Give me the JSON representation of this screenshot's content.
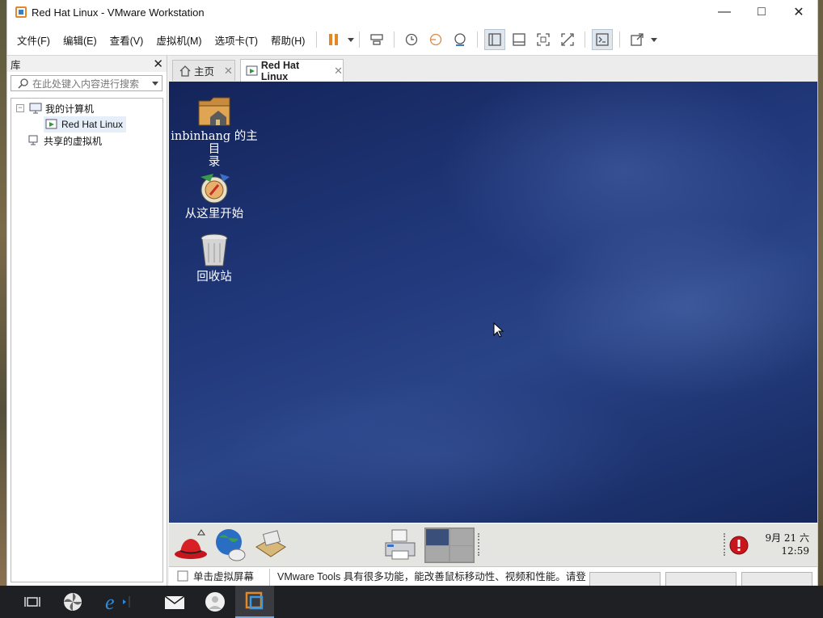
{
  "window": {
    "title": "Red Hat Linux  - VMware Workstation"
  },
  "menu": [
    "文件(F)",
    "编辑(E)",
    "查看(V)",
    "虚拟机(M)",
    "选项卡(T)",
    "帮助(H)"
  ],
  "toolbar": {
    "icons": [
      "pause-icon",
      "send-ctrl-alt-del-icon",
      "snapshot-icon",
      "revert-snapshot-icon",
      "snapshot-manager-icon",
      "library-view-icon",
      "thumbnail-view-icon",
      "fullscreen-icon",
      "unity-icon",
      "console-icon",
      "stretch-icon"
    ]
  },
  "library": {
    "title": "库",
    "search_placeholder": "在此处键入内容进行搜索",
    "tree": [
      {
        "label": "我的计算机"
      },
      {
        "label": "Red Hat Linux"
      },
      {
        "label": "共享的虚拟机"
      }
    ]
  },
  "tabs": [
    {
      "label": "主页"
    },
    {
      "label": "Red Hat Linux"
    }
  ],
  "guest": {
    "desktop_icons": [
      {
        "label": "inbinhang 的主目\n录",
        "icon": "home-folder-icon"
      },
      {
        "label": "从这里开始",
        "icon": "start-here-icon"
      },
      {
        "label": "回收站",
        "icon": "trash-icon"
      }
    ],
    "clock": {
      "date": "9月 21 六",
      "time": "12:59"
    }
  },
  "notification": {
    "left_text": "单击虚拟屏幕",
    "message": "VMware Tools 具有很多功能，能改善鼠标移动性、视频和性能。请登"
  },
  "colors": {
    "desktop": "#1f3677",
    "accent": "#e0892a"
  }
}
